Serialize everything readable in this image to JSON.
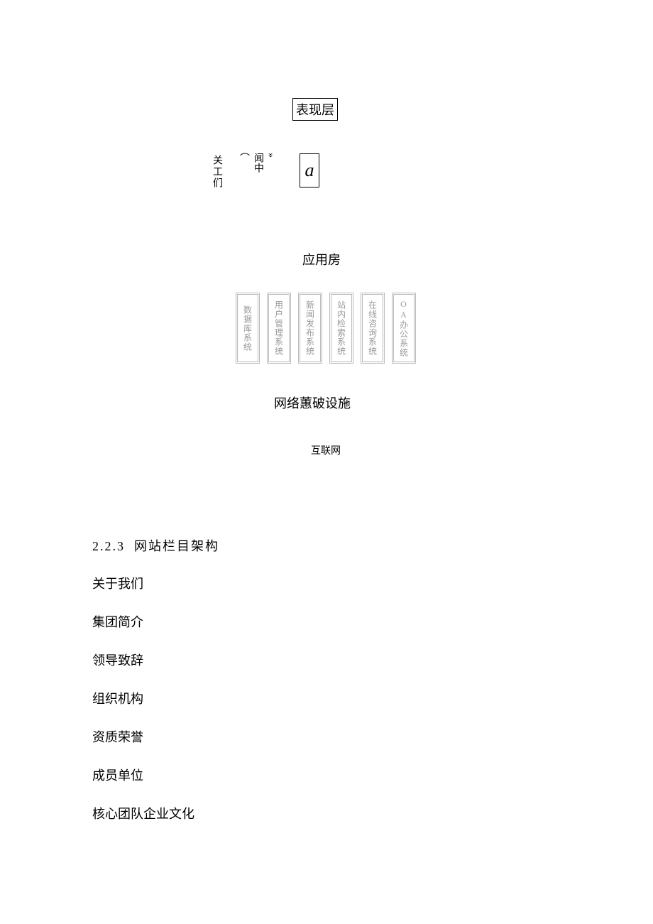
{
  "presentation_layer": {
    "label": "表现层",
    "col1": "关工们",
    "col2_top": "»",
    "col2_mid": "闻中",
    "col2_bottom": "⌒",
    "box_a": "a"
  },
  "application_layer": {
    "label": "应用房",
    "boxes": [
      "数据库系统",
      "用户管理系统",
      "新闻发布系统",
      "站内检索系统",
      "在线咨询系统",
      "OA办公系统"
    ]
  },
  "network_layer": {
    "label": "网络蕙破设施"
  },
  "internet": {
    "label": "互联网"
  },
  "section": {
    "number": "2.2.3",
    "title": "网站栏目架构"
  },
  "list_items": [
    "关于我们",
    "集团简介",
    "领导致辞",
    "组织机构",
    "资质荣誉",
    "成员单位",
    "核心团队企业文化"
  ]
}
